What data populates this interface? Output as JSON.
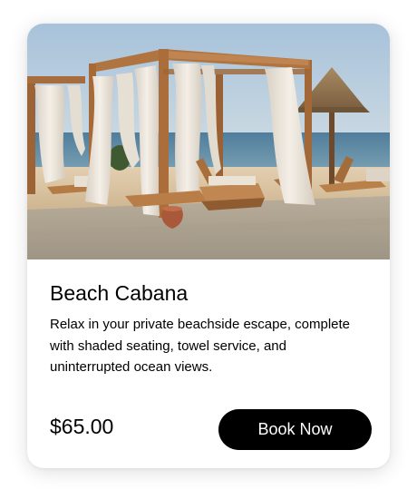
{
  "card": {
    "image": {
      "subject": "beach cabanas with white curtains, wooden loungers, thatched umbrella and ocean",
      "colors": {
        "sky": "#a9c4dc",
        "sea": "#5d8aa6",
        "sand": "#d9c4a4",
        "wood": "#b0743f",
        "curtain": "#ece6dc",
        "pavement": "#bfb29c"
      }
    },
    "title": "Beach Cabana",
    "description": "Relax in your private beachside escape, complete with shaded seating, towel service, and uninterrupted ocean views.",
    "price": "$65.00",
    "button": {
      "label": "Book Now",
      "background": "#000000",
      "text_color": "#ffffff"
    }
  }
}
